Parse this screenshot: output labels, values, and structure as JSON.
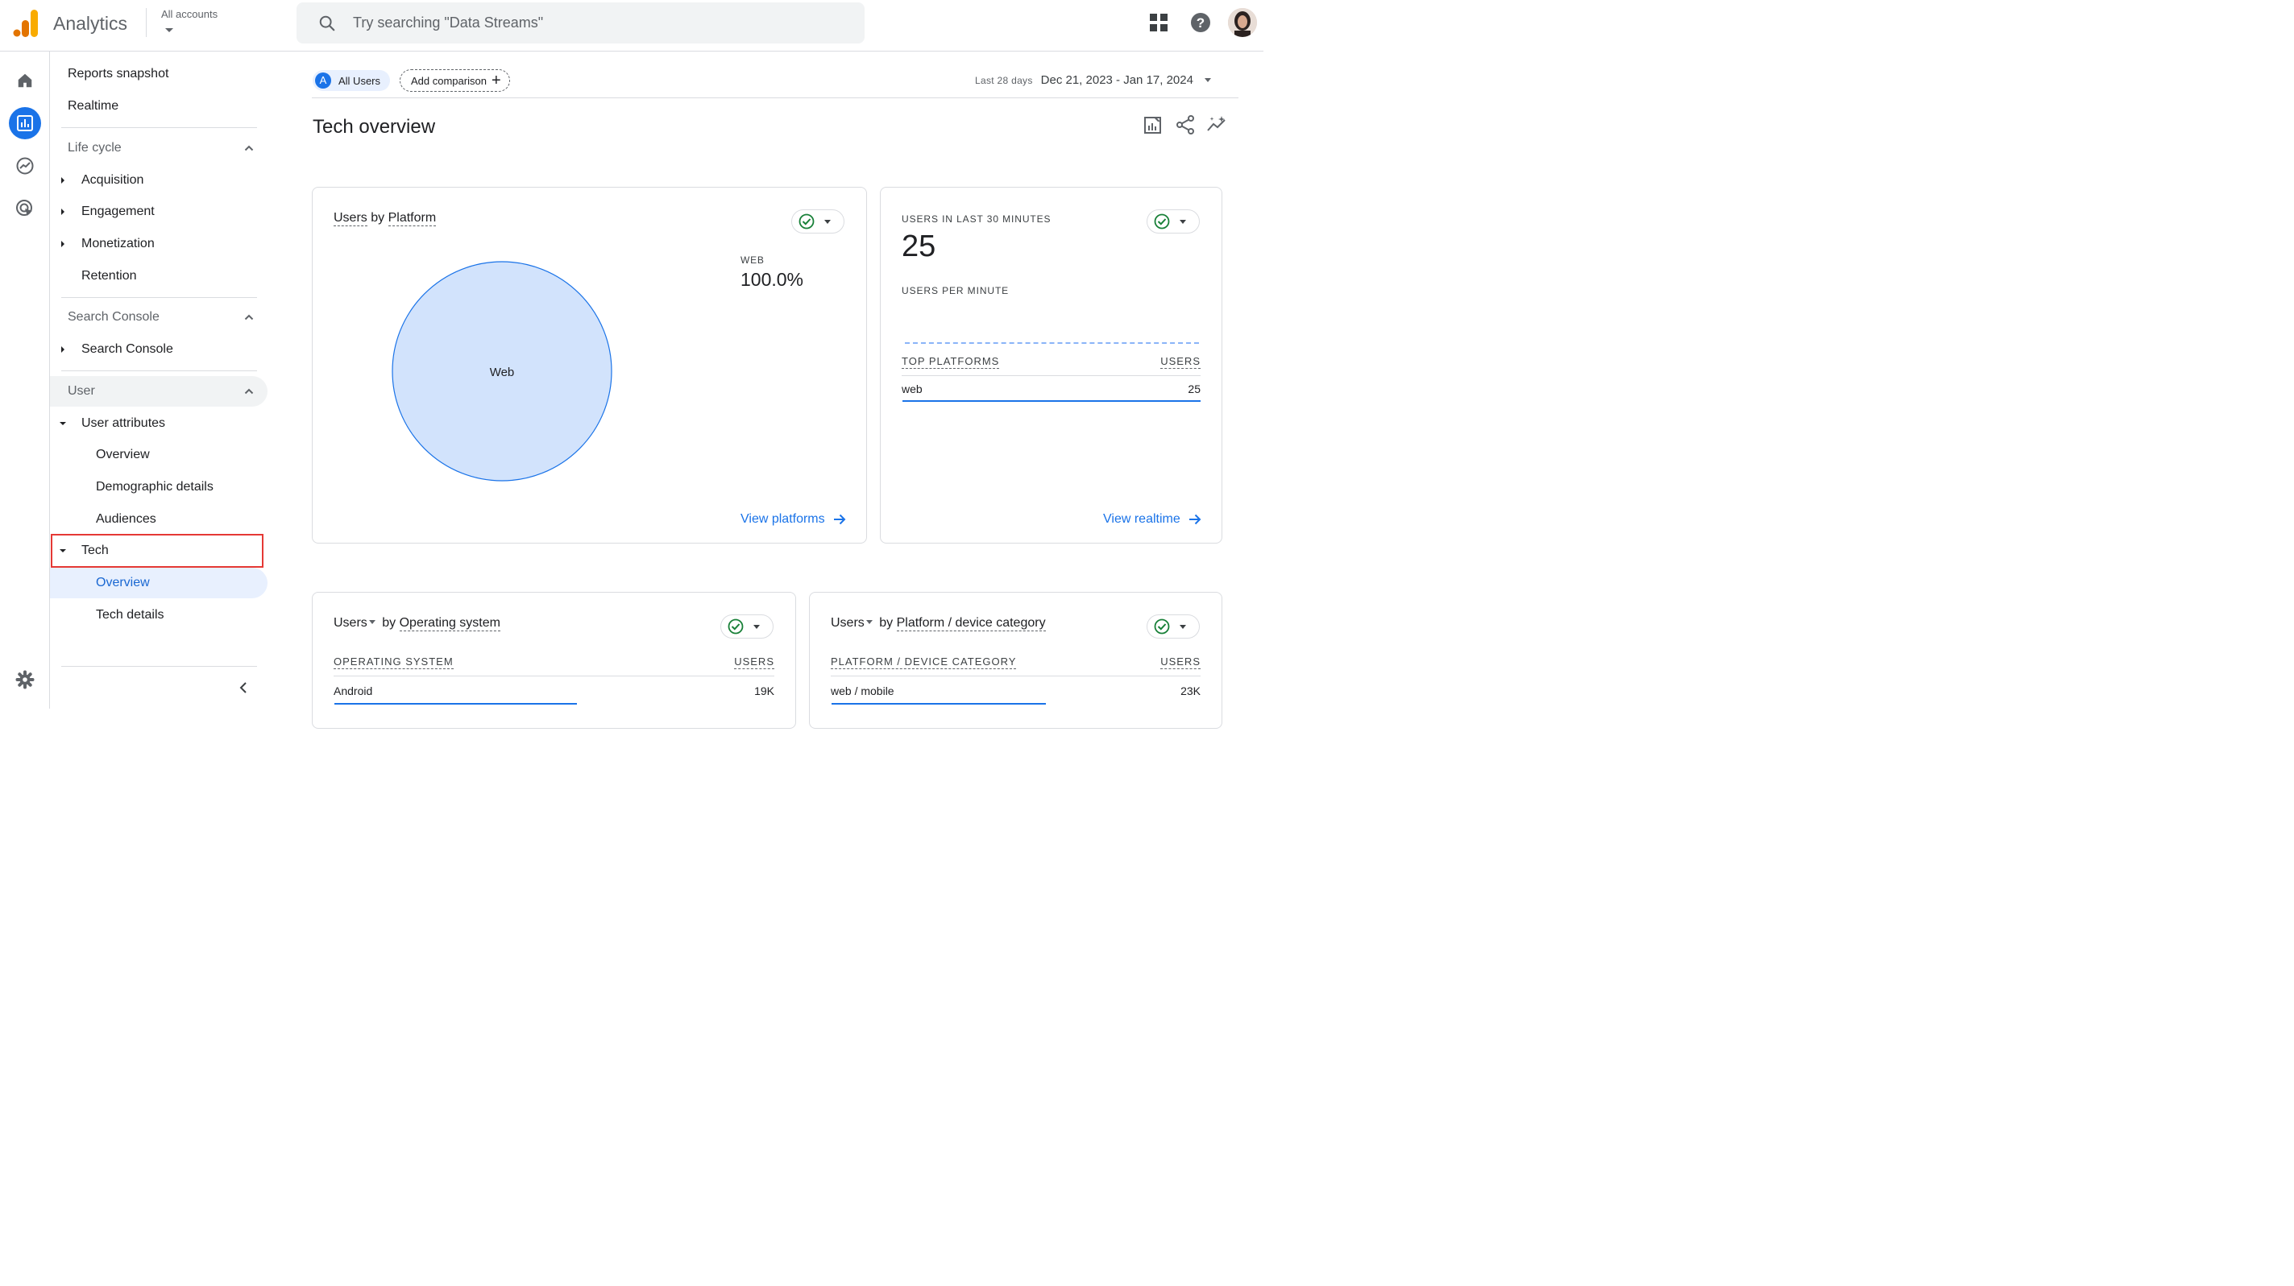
{
  "header": {
    "app_title": "Analytics",
    "account_label": "All accounts",
    "search_placeholder": "Try searching \"Data Streams\"",
    "icons": [
      "apps-grid-icon",
      "help-icon",
      "avatar"
    ]
  },
  "rail": {
    "items": [
      "home-icon",
      "reports-icon",
      "explore-icon",
      "advertising-icon",
      "admin-gear-icon"
    ],
    "active": "reports-icon"
  },
  "nav": {
    "reports_snapshot": "Reports snapshot",
    "realtime": "Realtime",
    "lifecycle": "Life cycle",
    "acquisition": "Acquisition",
    "engagement": "Engagement",
    "monetization": "Monetization",
    "retention": "Retention",
    "search_console_section": "Search Console",
    "search_console": "Search Console",
    "user_section": "User",
    "user_attributes": "User attributes",
    "overview": "Overview",
    "demographic_details": "Demographic details",
    "audiences": "Audiences",
    "tech": "Tech",
    "tech_overview": "Overview",
    "tech_details": "Tech details"
  },
  "toolbar": {
    "segment_letter": "A",
    "segment_label": "All Users",
    "add_comparison": "Add comparison",
    "date_preset": "Last 28 days",
    "date_range": "Dec 21, 2023 - Jan 17, 2024"
  },
  "page": {
    "title": "Tech overview"
  },
  "platform_card": {
    "title_metric": "Users",
    "title_by": "by",
    "title_dimension": "Platform",
    "legend_label": "WEB",
    "legend_value": "100.0%",
    "slice_label": "Web",
    "view_link": "View platforms",
    "colors": {
      "slice_fill": "#d2e3fc",
      "slice_stroke": "#1a73e8"
    }
  },
  "realtime_card": {
    "users_label": "USERS IN LAST 30 MINUTES",
    "users_value": "25",
    "per_minute_label": "USERS PER MINUTE",
    "top_platforms_head": "TOP PLATFORMS",
    "users_head": "USERS",
    "rows": [
      {
        "name": "web",
        "value": "25"
      }
    ],
    "view_link": "View realtime"
  },
  "os_card": {
    "title_metric": "Users",
    "title_by": "by",
    "title_dimension": "Operating system",
    "col_dimension": "OPERATING SYSTEM",
    "col_metric": "USERS",
    "rows": [
      {
        "name": "Android",
        "value": "19K",
        "fraction": 0.55
      }
    ]
  },
  "device_card": {
    "title_metric": "Users",
    "title_by": "by",
    "title_dimension": "Platform / device category",
    "col_dimension": "PLATFORM / DEVICE CATEGORY",
    "col_metric": "USERS",
    "rows": [
      {
        "name": "web / mobile",
        "value": "23K",
        "fraction": 0.58
      }
    ]
  },
  "chart_data": {
    "type": "pie",
    "categories": [
      "Web"
    ],
    "values": [
      100.0
    ],
    "title": "Users by Platform",
    "legend": [
      {
        "label": "WEB",
        "value": "100.0%"
      }
    ]
  }
}
